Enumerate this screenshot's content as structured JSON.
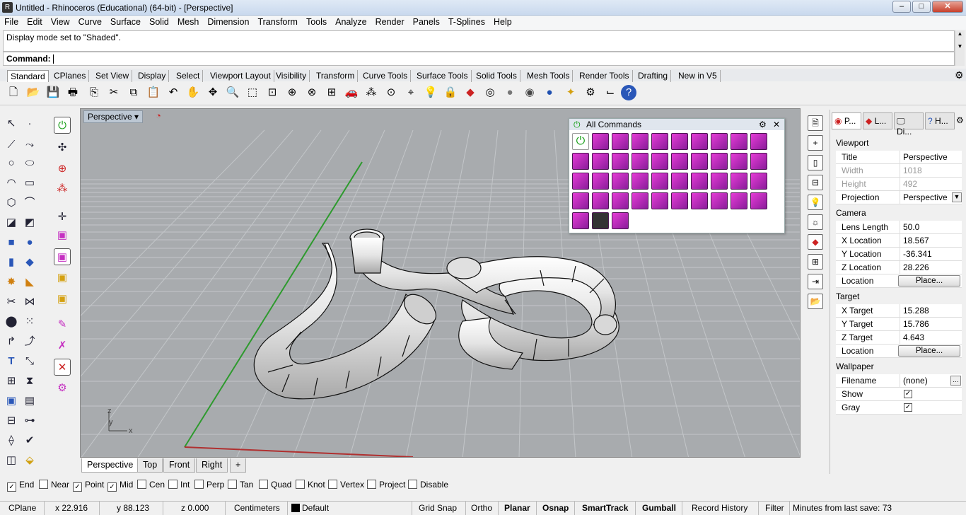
{
  "titlebar": {
    "title": "Untitled - Rhinoceros (Educational) (64-bit) - [Perspective]"
  },
  "menu": [
    "File",
    "Edit",
    "View",
    "Curve",
    "Surface",
    "Solid",
    "Mesh",
    "Dimension",
    "Transform",
    "Tools",
    "Analyze",
    "Render",
    "Panels",
    "T-Splines",
    "Help"
  ],
  "command_history": "Display mode set to \"Shaded\".",
  "command_prompt": "Command:",
  "toolbar_tabs": [
    "Standard",
    "CPlanes",
    "Set View",
    "Display",
    "Select",
    "Viewport Layout",
    "Visibility",
    "Transform",
    "Curve Tools",
    "Surface Tools",
    "Solid Tools",
    "Mesh Tools",
    "Render Tools",
    "Drafting",
    "New in V5"
  ],
  "viewport": {
    "label": "Perspective",
    "axis_z": "z",
    "axis_y": "y",
    "axis_x": "x"
  },
  "viewport_tabs": [
    "Perspective",
    "Top",
    "Front",
    "Right"
  ],
  "all_commands_panel": {
    "title": "All Commands"
  },
  "panel": {
    "tabs": [
      "P...",
      "L...",
      "Di...",
      "H..."
    ],
    "sections": {
      "viewport": "Viewport",
      "camera": "Camera",
      "target": "Target",
      "wallpaper": "Wallpaper"
    },
    "rows": {
      "title_label": "Title",
      "title_value": "Perspective",
      "width_label": "Width",
      "width_value": "1018",
      "height_label": "Height",
      "height_value": "492",
      "projection_label": "Projection",
      "projection_value": "Perspective",
      "lens_label": "Lens Length",
      "lens_value": "50.0",
      "xloc_label": "X Location",
      "xloc_value": "18.567",
      "yloc_label": "Y Location",
      "yloc_value": "-36.341",
      "zloc_label": "Z Location",
      "zloc_value": "28.226",
      "cam_loc_label": "Location",
      "cam_place": "Place...",
      "xt_label": "X Target",
      "xt_value": "15.288",
      "yt_label": "Y Target",
      "yt_value": "15.786",
      "zt_label": "Z Target",
      "zt_value": "4.643",
      "tgt_loc_label": "Location",
      "tgt_place": "Place...",
      "filename_label": "Filename",
      "filename_value": "(none)",
      "show_label": "Show",
      "gray_label": "Gray"
    }
  },
  "osnap": [
    {
      "label": "End",
      "checked": true
    },
    {
      "label": "Near",
      "checked": false
    },
    {
      "label": "Point",
      "checked": true
    },
    {
      "label": "Mid",
      "checked": true
    },
    {
      "label": "Cen",
      "checked": false
    },
    {
      "label": "Int",
      "checked": false
    },
    {
      "label": "Perp",
      "checked": false
    },
    {
      "label": "Tan",
      "checked": false
    },
    {
      "label": "Quad",
      "checked": false
    },
    {
      "label": "Knot",
      "checked": false
    },
    {
      "label": "Vertex",
      "checked": false
    },
    {
      "label": "Project",
      "checked": false
    },
    {
      "label": "Disable",
      "checked": false
    }
  ],
  "status": {
    "cplane": "CPlane",
    "x": "x 22.916",
    "y": "y 88.123",
    "z": "z 0.000",
    "units": "Centimeters",
    "layer": "Default",
    "grid_snap": "Grid Snap",
    "ortho": "Ortho",
    "planar": "Planar",
    "osnap": "Osnap",
    "smarttrack": "SmartTrack",
    "gumball": "Gumball",
    "record_history": "Record History",
    "filter": "Filter",
    "minutes": "Minutes from last save: 73"
  },
  "colors": {
    "accent_magenta": "#c52fc1",
    "viewport_bg": "#a8abae",
    "x_axis": "#b03030",
    "y_axis": "#2e9a2e"
  }
}
